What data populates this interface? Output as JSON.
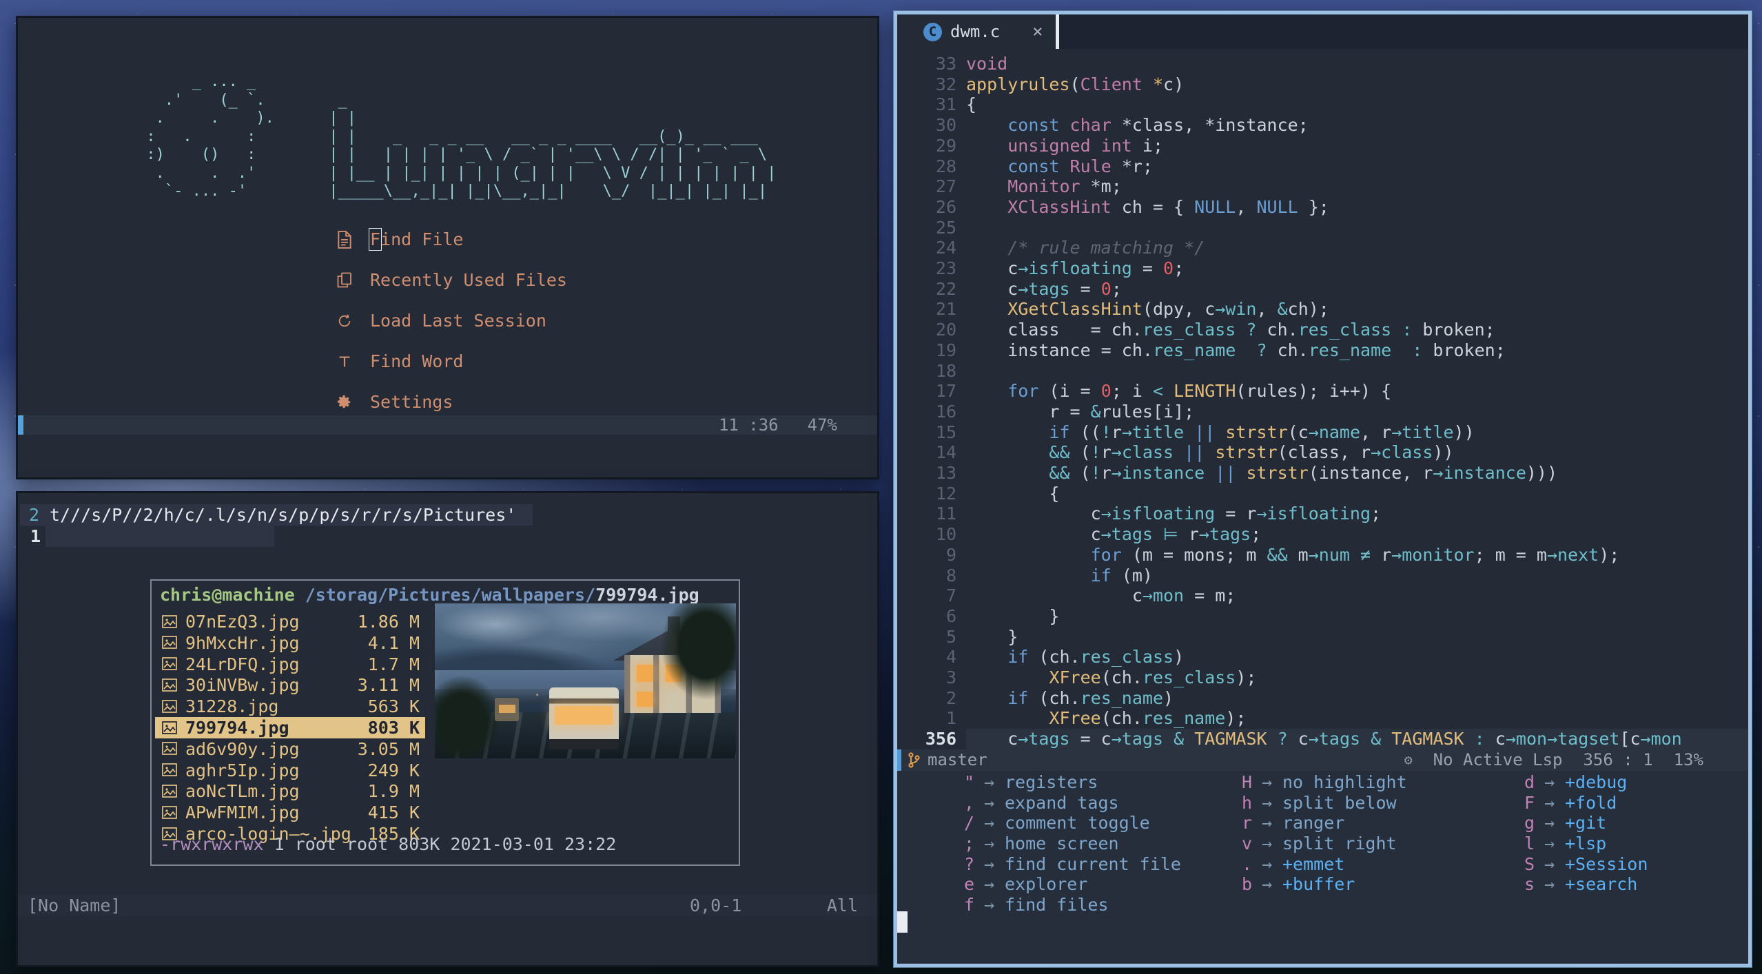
{
  "dashboard": {
    "ascii_art": [
      "        _ ... _",
      "     .'    (_ `.        _",
      "    .     .    ).      | |",
      "   :   .      :        | |    _   _ _ __   __ _ _ ____   __(_)_ __ ___",
      "   :)    ()   :        | |   | | | | '_ \\ / _` | '__\\ \\ / /| | '_ ` _ \\",
      "    .     .  .'        | |__ | |_| | | | | (_| | |   \\ V / | | | | | | |",
      "     `- ... -'         |_____\\__,_|_| |_|\\__,_|_|    \\_/  |_|_| |_| |_|"
    ],
    "menu": [
      {
        "icon": "file-icon",
        "label": "Find File",
        "cursor": true
      },
      {
        "icon": "copy-icon",
        "label": "Recently Used Files"
      },
      {
        "icon": "refresh-icon",
        "label": "Load Last Session"
      },
      {
        "icon": "letter-t-icon",
        "label": "Find Word"
      },
      {
        "icon": "gear-icon",
        "label": "Settings"
      }
    ],
    "statusline": {
      "time": "11 :36",
      "battery": "47%"
    }
  },
  "files_window": {
    "line2": {
      "num": "2",
      "text": "t///s/P//2/h/c/.l/s/n/s/p/p/s/r/r/s/Pictures'"
    },
    "line1": {
      "num": "1"
    },
    "popup": {
      "user": "chris@machine",
      "dir": " /storag/Pictures/wallpapers/",
      "file": "799794.jpg",
      "entries": [
        {
          "name": "07nEzQ3.jpg",
          "size": "1.86 M"
        },
        {
          "name": "9hMxcHr.jpg",
          "size": "4.1 M"
        },
        {
          "name": "24LrDFQ.jpg",
          "size": "1.7 M"
        },
        {
          "name": "30iNVBw.jpg",
          "size": "3.11 M"
        },
        {
          "name": "31228.jpg",
          "size": "563 K"
        },
        {
          "name": "799794.jpg",
          "size": "803 K",
          "selected": true
        },
        {
          "name": "ad6v90y.jpg",
          "size": "3.05 M"
        },
        {
          "name": "aghr5Ip.jpg",
          "size": "249 K"
        },
        {
          "name": "aoNcTLm.jpg",
          "size": "1.9 M"
        },
        {
          "name": "APwFMIM.jpg",
          "size": "415 K"
        },
        {
          "name": "arco-login—~.jpg",
          "size": "185 K"
        }
      ],
      "details": {
        "perms": "-rwxrwxrwx",
        "info": " 1 root root 803K 2021-03-01 23:22"
      }
    },
    "statusline": {
      "name": "[No Name]",
      "pos": "0,0-1",
      "scroll": "All"
    }
  },
  "editor": {
    "tab": {
      "lang_badge": "C",
      "title": "dwm.c",
      "close": "×"
    },
    "code": [
      {
        "n": "33",
        "t": [
          [
            "void",
            "t"
          ]
        ]
      },
      {
        "n": "32",
        "t": [
          [
            "applyrules",
            "f"
          ],
          [
            "(",
            "p"
          ],
          [
            "Client",
            "t"
          ],
          [
            " ",
            "p"
          ],
          [
            "*",
            "f"
          ],
          [
            "c)",
            "p"
          ]
        ]
      },
      {
        "n": "31",
        "t": [
          [
            "{",
            "p"
          ]
        ]
      },
      {
        "n": "30",
        "t": [
          [
            "    ",
            "p"
          ],
          [
            "const",
            "k"
          ],
          [
            " ",
            "p"
          ],
          [
            "char",
            "t"
          ],
          [
            " *class, *instance;",
            "p"
          ]
        ]
      },
      {
        "n": "29",
        "t": [
          [
            "    ",
            "p"
          ],
          [
            "unsigned",
            "t"
          ],
          [
            " ",
            "p"
          ],
          [
            "int",
            "t"
          ],
          [
            " i;",
            "p"
          ]
        ]
      },
      {
        "n": "28",
        "t": [
          [
            "    ",
            "p"
          ],
          [
            "const",
            "k"
          ],
          [
            " ",
            "p"
          ],
          [
            "Rule",
            "t"
          ],
          [
            " *r;",
            "p"
          ]
        ]
      },
      {
        "n": "27",
        "t": [
          [
            "    ",
            "p"
          ],
          [
            "Monitor",
            "t"
          ],
          [
            " *m;",
            "p"
          ]
        ]
      },
      {
        "n": "26",
        "t": [
          [
            "    ",
            "p"
          ],
          [
            "XClassHint",
            "t"
          ],
          [
            " ch = { ",
            "p"
          ],
          [
            "NULL",
            "k"
          ],
          [
            ", ",
            "p"
          ],
          [
            "NULL",
            "k"
          ],
          [
            " };",
            "p"
          ]
        ]
      },
      {
        "n": "25",
        "t": []
      },
      {
        "n": "24",
        "t": [
          [
            "    ",
            "p"
          ],
          [
            "/* rule matching */",
            "c"
          ]
        ]
      },
      {
        "n": "23",
        "t": [
          [
            "    c",
            "p"
          ],
          [
            "→isfloating",
            "m"
          ],
          [
            " = ",
            "p"
          ],
          [
            "0",
            "n"
          ],
          [
            ";",
            "p"
          ]
        ]
      },
      {
        "n": "22",
        "t": [
          [
            "    c",
            "p"
          ],
          [
            "→tags",
            "m"
          ],
          [
            " = ",
            "p"
          ],
          [
            "0",
            "n"
          ],
          [
            ";",
            "p"
          ]
        ]
      },
      {
        "n": "21",
        "t": [
          [
            "    ",
            "p"
          ],
          [
            "XGetClassHint",
            "f"
          ],
          [
            "(dpy, c",
            "p"
          ],
          [
            "→win",
            "m"
          ],
          [
            ", ",
            "p"
          ],
          [
            "&",
            "m"
          ],
          [
            "ch);",
            "p"
          ]
        ]
      },
      {
        "n": "20",
        "t": [
          [
            "    class   = ch.",
            "p"
          ],
          [
            "res_class",
            "m"
          ],
          [
            " ",
            "p"
          ],
          [
            "?",
            "m"
          ],
          [
            " ch.",
            "p"
          ],
          [
            "res_class",
            "m"
          ],
          [
            " ",
            "p"
          ],
          [
            ":",
            "m"
          ],
          [
            " broken;",
            "p"
          ]
        ]
      },
      {
        "n": "19",
        "t": [
          [
            "    instance = ch.",
            "p"
          ],
          [
            "res_name",
            "m"
          ],
          [
            "  ",
            "p"
          ],
          [
            "?",
            "m"
          ],
          [
            " ch.",
            "p"
          ],
          [
            "res_name",
            "m"
          ],
          [
            "  ",
            "p"
          ],
          [
            ":",
            "m"
          ],
          [
            " broken;",
            "p"
          ]
        ]
      },
      {
        "n": "18",
        "t": []
      },
      {
        "n": "17",
        "t": [
          [
            "    ",
            "p"
          ],
          [
            "for",
            "k"
          ],
          [
            " (i = ",
            "p"
          ],
          [
            "0",
            "n"
          ],
          [
            "; i ",
            "p"
          ],
          [
            "<",
            "m"
          ],
          [
            " ",
            "p"
          ],
          [
            "LENGTH",
            "f"
          ],
          [
            "(rules); i++) {",
            "p"
          ]
        ]
      },
      {
        "n": "16",
        "t": [
          [
            "        r = ",
            "p"
          ],
          [
            "&",
            "m"
          ],
          [
            "rules[i];",
            "p"
          ]
        ]
      },
      {
        "n": "15",
        "t": [
          [
            "        ",
            "p"
          ],
          [
            "if",
            "k"
          ],
          [
            " ((",
            "p"
          ],
          [
            "!",
            "m"
          ],
          [
            "r",
            "p"
          ],
          [
            "→title",
            "m"
          ],
          [
            " ",
            "p"
          ],
          [
            "||",
            "k"
          ],
          [
            " ",
            "p"
          ],
          [
            "strstr",
            "f"
          ],
          [
            "(c",
            "p"
          ],
          [
            "→name",
            "m"
          ],
          [
            ", r",
            "p"
          ],
          [
            "→title",
            "m"
          ],
          [
            "))",
            "p"
          ]
        ]
      },
      {
        "n": "14",
        "t": [
          [
            "        ",
            "p"
          ],
          [
            "&&",
            "m"
          ],
          [
            " (",
            "p"
          ],
          [
            "!",
            "m"
          ],
          [
            "r",
            "p"
          ],
          [
            "→class",
            "m"
          ],
          [
            " ",
            "p"
          ],
          [
            "||",
            "k"
          ],
          [
            " ",
            "p"
          ],
          [
            "strstr",
            "f"
          ],
          [
            "(class, r",
            "p"
          ],
          [
            "→class",
            "m"
          ],
          [
            "))",
            "p"
          ]
        ]
      },
      {
        "n": "13",
        "t": [
          [
            "        ",
            "p"
          ],
          [
            "&&",
            "m"
          ],
          [
            " (",
            "p"
          ],
          [
            "!",
            "m"
          ],
          [
            "r",
            "p"
          ],
          [
            "→instance",
            "m"
          ],
          [
            " ",
            "p"
          ],
          [
            "||",
            "k"
          ],
          [
            " ",
            "p"
          ],
          [
            "strstr",
            "f"
          ],
          [
            "(instance, r",
            "p"
          ],
          [
            "→instance",
            "m"
          ],
          [
            ")))",
            "p"
          ]
        ]
      },
      {
        "n": "12",
        "t": [
          [
            "        {",
            "p"
          ]
        ]
      },
      {
        "n": "11",
        "t": [
          [
            "            c",
            "p"
          ],
          [
            "→isfloating",
            "m"
          ],
          [
            " = r",
            "p"
          ],
          [
            "→isfloating",
            "m"
          ],
          [
            ";",
            "p"
          ]
        ]
      },
      {
        "n": "10",
        "t": [
          [
            "            c",
            "p"
          ],
          [
            "→tags",
            "m"
          ],
          [
            " ",
            "p"
          ],
          [
            "⊨",
            "m"
          ],
          [
            " r",
            "p"
          ],
          [
            "→tags",
            "m"
          ],
          [
            ";",
            "p"
          ]
        ]
      },
      {
        "n": "9",
        "t": [
          [
            "            ",
            "p"
          ],
          [
            "for",
            "k"
          ],
          [
            " (m = mons; m ",
            "p"
          ],
          [
            "&&",
            "m"
          ],
          [
            " m",
            "p"
          ],
          [
            "→num",
            "m"
          ],
          [
            " ",
            "p"
          ],
          [
            "≠",
            "m"
          ],
          [
            " r",
            "p"
          ],
          [
            "→monitor",
            "m"
          ],
          [
            "; m = m",
            "p"
          ],
          [
            "→next",
            "m"
          ],
          [
            ");",
            "p"
          ]
        ]
      },
      {
        "n": "8",
        "t": [
          [
            "            ",
            "p"
          ],
          [
            "if",
            "k"
          ],
          [
            " (m)",
            "p"
          ]
        ]
      },
      {
        "n": "7",
        "t": [
          [
            "                c",
            "p"
          ],
          [
            "→mon",
            "m"
          ],
          [
            " = m;",
            "p"
          ]
        ]
      },
      {
        "n": "6",
        "t": [
          [
            "        }",
            "p"
          ]
        ]
      },
      {
        "n": "5",
        "t": [
          [
            "    }",
            "p"
          ]
        ]
      },
      {
        "n": "4",
        "t": [
          [
            "    ",
            "p"
          ],
          [
            "if",
            "k"
          ],
          [
            " (ch.",
            "p"
          ],
          [
            "res_class",
            "m"
          ],
          [
            ")",
            "p"
          ]
        ]
      },
      {
        "n": "3",
        "t": [
          [
            "        ",
            "p"
          ],
          [
            "XFree",
            "f"
          ],
          [
            "(ch.",
            "p"
          ],
          [
            "res_class",
            "m"
          ],
          [
            ");",
            "p"
          ]
        ]
      },
      {
        "n": "2",
        "t": [
          [
            "    ",
            "p"
          ],
          [
            "if",
            "k"
          ],
          [
            " (ch.",
            "p"
          ],
          [
            "res_name",
            "m"
          ],
          [
            ")",
            "p"
          ]
        ]
      },
      {
        "n": "1",
        "t": [
          [
            "        ",
            "p"
          ],
          [
            "XFree",
            "f"
          ],
          [
            "(ch.",
            "p"
          ],
          [
            "res_name",
            "m"
          ],
          [
            ");",
            "p"
          ]
        ]
      },
      {
        "n": "356",
        "cur": true,
        "t": [
          [
            "    c",
            "p"
          ],
          [
            "→tags",
            "m"
          ],
          [
            " = c",
            "p"
          ],
          [
            "→tags",
            "m"
          ],
          [
            " ",
            "p"
          ],
          [
            "&",
            "m"
          ],
          [
            " ",
            "p"
          ],
          [
            "TAGMASK",
            "f"
          ],
          [
            " ",
            "p"
          ],
          [
            "?",
            "m"
          ],
          [
            " c",
            "p"
          ],
          [
            "→tags",
            "m"
          ],
          [
            " ",
            "p"
          ],
          [
            "&",
            "m"
          ],
          [
            " ",
            "p"
          ],
          [
            "TAGMASK",
            "f"
          ],
          [
            " ",
            "p"
          ],
          [
            ":",
            "m"
          ],
          [
            " c",
            "p"
          ],
          [
            "→mon",
            "m"
          ],
          [
            "→tagset",
            "m"
          ],
          [
            "[c",
            "p"
          ],
          [
            "→mon",
            "m"
          ]
        ]
      }
    ],
    "statusline": {
      "branch": "master",
      "lsp": "No Active Lsp",
      "pos": "356 : 1",
      "percent": "13%"
    },
    "whichkey": {
      "arrow": "→",
      "columns": [
        [
          {
            "key": "\"",
            "label": "registers"
          },
          {
            "key": ",",
            "label": "expand tags"
          },
          {
            "key": "/",
            "label": "comment toggle"
          },
          {
            "key": ";",
            "label": "home screen"
          },
          {
            "key": "?",
            "label": "find current file"
          },
          {
            "key": "e",
            "label": "explorer"
          },
          {
            "key": "f",
            "label": "find files"
          }
        ],
        [
          {
            "key": "H",
            "label": "no highlight"
          },
          {
            "key": "h",
            "label": "split below"
          },
          {
            "key": "r",
            "label": "ranger"
          },
          {
            "key": "v",
            "label": "split right"
          },
          {
            "key": ".",
            "label": "+emmet"
          },
          {
            "key": "b",
            "label": "+buffer"
          }
        ],
        [
          {
            "key": "d",
            "label": "+debug"
          },
          {
            "key": "F",
            "label": "+fold"
          },
          {
            "key": "g",
            "label": "+git"
          },
          {
            "key": "l",
            "label": "+lsp"
          },
          {
            "key": "S",
            "label": "+Session"
          },
          {
            "key": "s",
            "label": "+search"
          }
        ]
      ]
    }
  }
}
